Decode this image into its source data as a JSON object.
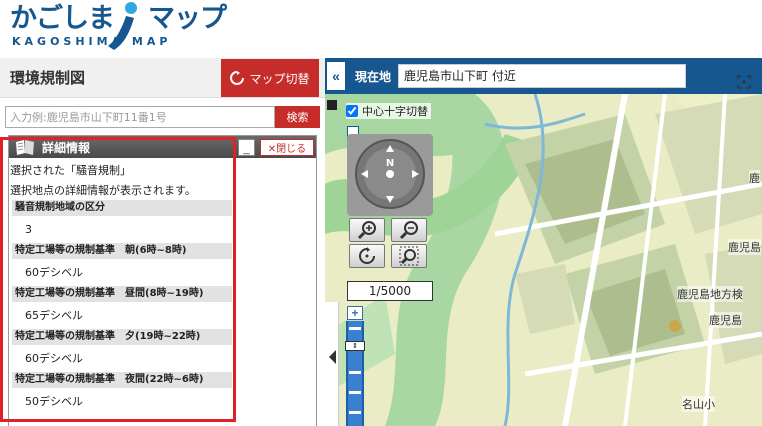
{
  "header": {
    "logo_main": "かごしま",
    "logo_main_tail": "マップ",
    "logo_sub": "KAGOSHIMA MAP"
  },
  "left_panel": {
    "title": "環境規制図",
    "switch_button": "マップ切替",
    "search": {
      "placeholder": "入力例:鹿児島市山下町11番1号",
      "value": "",
      "button": "検索"
    }
  },
  "detail": {
    "title": "詳細情報",
    "minimize_label": "_",
    "close_label": "✕閉じる",
    "desc_1": "選択された「騒音規制」",
    "desc_2": "選択地点の詳細情報が表示されます。",
    "rows": [
      {
        "label": "騒音規制地域の区分",
        "value": "3"
      },
      {
        "label": "特定工場等の規制基準　朝(6時~8時)",
        "value": "60デシベル"
      },
      {
        "label": "特定工場等の規制基準　昼間(8時~19時)",
        "value": "65デシベル"
      },
      {
        "label": "特定工場等の規制基準　夕(19時~22時)",
        "value": "60デシベル"
      },
      {
        "label": "特定工場等の規制基準　夜間(22時~6時)",
        "value": "50デシベル"
      }
    ]
  },
  "map": {
    "collapse": "«",
    "location_label": "現在地",
    "location_value": "鹿児島市山下町 付近",
    "crosshair_label": "中心十字切替",
    "compass": "N",
    "scale": "1/5000",
    "zoom_in_label": "+",
    "labels": {
      "l1": "鹿児島",
      "l2": "鹿児島地方検",
      "l3": "鹿児島",
      "l4": "名山小",
      "l5": "鹿"
    }
  },
  "colors": {
    "brand_blue": "#17578f",
    "accent_red": "#c62d2a",
    "highlight": "#e0202a"
  }
}
